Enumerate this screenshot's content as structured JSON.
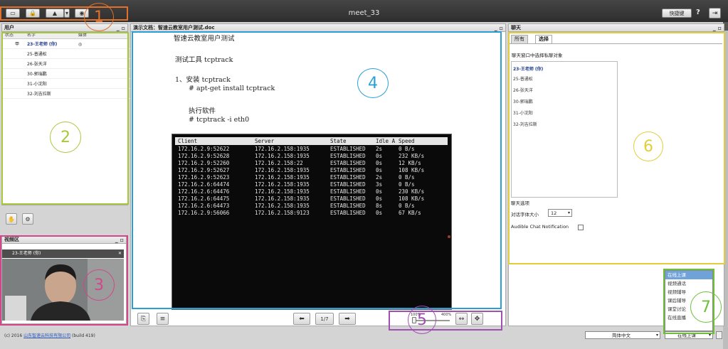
{
  "topbar": {
    "meeting_title": "meet_33",
    "hotkey_label": "快捷键",
    "help_label": "?",
    "exit_label": "⇥"
  },
  "users_panel": {
    "title": "用户",
    "columns": [
      "状态",
      "名字",
      "媒体"
    ],
    "users": [
      {
        "name": "23-王老师 (你)",
        "status": "甲",
        "media": "◎"
      },
      {
        "name": "25-普通松",
        "status": "",
        "media": ""
      },
      {
        "name": "26-张天洋",
        "status": "",
        "media": ""
      },
      {
        "name": "30-郭瑞鹏",
        "status": "",
        "media": ""
      },
      {
        "name": "31-小沈阳",
        "status": "",
        "media": ""
      },
      {
        "name": "32-刘吉拉斯",
        "status": "",
        "media": ""
      }
    ]
  },
  "video_panel": {
    "title": "视频区",
    "caption": "23-王老师 (你)"
  },
  "document_panel": {
    "title": "演示文档：智速云教室用户测试.doc",
    "lines": {
      "line1": "智速云教室用户测试",
      "line2": "测试工具 tcptrack",
      "line3": "1、安装 tcptrack",
      "line4": "# apt-get install tcptrack",
      "line5": "执行软件",
      "line6": "# tcptrack -i eth0"
    },
    "terminal": {
      "headers": [
        "Client",
        "Server",
        "State",
        "Idle A",
        "Speed"
      ],
      "rows": [
        [
          "172.16.2.9:52622",
          "172.16.2.158:1935",
          "ESTABLISHED",
          "2s",
          "0 B/s"
        ],
        [
          "172.16.2.9:52628",
          "172.16.2.158:1935",
          "ESTABLISHED",
          "0s",
          "232 KB/s"
        ],
        [
          "172.16.2.9:52260",
          "172.16.2.158:22",
          "ESTABLISHED",
          "0s",
          "12 KB/s"
        ],
        [
          "172.16.2.9:52627",
          "172.16.2.158:1935",
          "ESTABLISHED",
          "0s",
          "108 KB/s"
        ],
        [
          "172.16.2.9:52623",
          "172.16.2.158:1935",
          "ESTABLISHED",
          "2s",
          "0 B/s"
        ],
        [
          "172.16.2.6:64474",
          "172.16.2.158:1935",
          "ESTABLISHED",
          "3s",
          "0 B/s"
        ],
        [
          "172.16.2.6:64476",
          "172.16.2.158:1935",
          "ESTABLISHED",
          "0s",
          "230 KB/s"
        ],
        [
          "172.16.2.6:64475",
          "172.16.2.158:1935",
          "ESTABLISHED",
          "0s",
          "108 KB/s"
        ],
        [
          "172.16.2.6:64473",
          "172.16.2.158:1935",
          "ESTABLISHED",
          "8s",
          "0 B/s"
        ],
        [
          "172.16.2.9:56066",
          "172.16.2.158:9123",
          "ESTABLISHED",
          "0s",
          "67 KB/s"
        ]
      ]
    },
    "page_indicator": "1/7",
    "zoom_min": "100%",
    "zoom_max": "400%"
  },
  "chat_panel": {
    "title": "聊天",
    "tabs": [
      "所有",
      "选择"
    ],
    "select_hint": "聊天窗口中选择私聊对象",
    "recipients": [
      "23-王老师 (你)",
      "25-普通松",
      "26-张天洋",
      "30-郭瑞鹏",
      "31-小沈阳",
      "32-刘吉拉斯"
    ],
    "options_title": "聊天选项",
    "font_size_label": "对话字体大小",
    "font_size_value": "12",
    "notification_label": "Audible Chat Notification",
    "status_menu": [
      "在线上课",
      "视频通话",
      "视频辅导",
      "课后辅导",
      "课堂讨论",
      "在线直播"
    ],
    "status_selected": "在线上课",
    "language_select": "简体中文"
  },
  "footer": {
    "copyright": "(c) 2016",
    "company": "山东智速云科技有限公司",
    "build": "(build 419)"
  },
  "annotations": {
    "labels": [
      "1",
      "2",
      "3",
      "4",
      "5",
      "6",
      "7"
    ],
    "colors": {
      "a1": "#e0702a",
      "a2": "#a8c83c",
      "a3": "#d2468a",
      "a4": "#2a9fd6",
      "a5": "#a050b0",
      "a6": "#e3cd3a",
      "a7": "#6fbf3a"
    }
  }
}
